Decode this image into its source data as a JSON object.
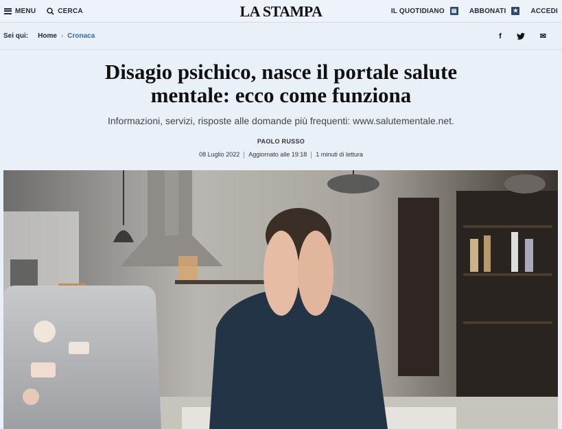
{
  "header": {
    "menu_label": "MENU",
    "search_label": "CERCA",
    "logo": "LA STAMPA",
    "quotidiano_label": "IL QUOTIDIANO",
    "abbonati_label": "ABBONATI",
    "accedi_label": "ACCEDI"
  },
  "breadcrumb": {
    "prefix": "Sei qui:",
    "home": "Home",
    "current": "Cronaca"
  },
  "social": {
    "facebook": "f",
    "twitter": "t",
    "email": "✉"
  },
  "article": {
    "title": "Disagio psichico, nasce il portale salute mentale: ecco come funziona",
    "subtitle": "Informazioni, servizi, risposte alle domande più frequenti: www.salutementale.net.",
    "author": "PAOLO RUSSO",
    "date": "08 Luglio 2022",
    "updated": "Aggiornato alle 19:18",
    "reading_time": "1 minuti di lettura"
  },
  "colors": {
    "background": "#e9f0f8",
    "accent": "#2a6cb0"
  }
}
